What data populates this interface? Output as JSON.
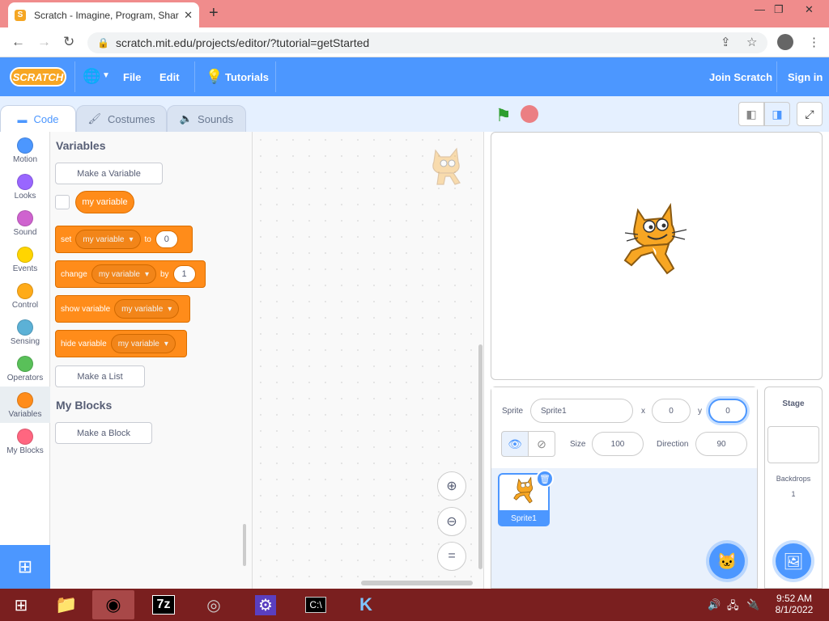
{
  "browser": {
    "tab_title": "Scratch - Imagine, Program, Share",
    "url": "scratch.mit.edu/projects/editor/?tutorial=getStarted",
    "favicon_letter": "S"
  },
  "menubar": {
    "logo": "SCRATCH",
    "file": "File",
    "edit": "Edit",
    "tutorials": "Tutorials",
    "join": "Join Scratch",
    "signin": "Sign in"
  },
  "tabs": [
    "Code",
    "Costumes",
    "Sounds"
  ],
  "categories": [
    {
      "label": "Motion",
      "color": "#4c97ff"
    },
    {
      "label": "Looks",
      "color": "#9966ff"
    },
    {
      "label": "Sound",
      "color": "#cf63cf"
    },
    {
      "label": "Events",
      "color": "#ffd500"
    },
    {
      "label": "Control",
      "color": "#ffab19"
    },
    {
      "label": "Sensing",
      "color": "#5cb1d6"
    },
    {
      "label": "Operators",
      "color": "#59c059"
    },
    {
      "label": "Variables",
      "color": "#ff8c1a"
    },
    {
      "label": "My Blocks",
      "color": "#ff6680"
    }
  ],
  "palette": {
    "variables_heading": "Variables",
    "make_variable": "Make a Variable",
    "variable_reporter": "my variable",
    "set_block": {
      "word": "set",
      "var": "my variable",
      "to": "to",
      "value": "0"
    },
    "change_block": {
      "word": "change",
      "var": "my variable",
      "by": "by",
      "value": "1"
    },
    "show_block": {
      "word": "show variable",
      "var": "my variable"
    },
    "hide_block": {
      "word": "hide variable",
      "var": "my variable"
    },
    "make_list": "Make a List",
    "myblocks_heading": "My Blocks",
    "make_block": "Make a Block"
  },
  "sprite_info": {
    "sprite_label": "Sprite",
    "sprite_name": "Sprite1",
    "x_label": "x",
    "x_value": "0",
    "y_label": "y",
    "y_value": "0",
    "size_label": "Size",
    "size_value": "100",
    "direction_label": "Direction",
    "direction_value": "90"
  },
  "sprite_list": [
    {
      "name": "Sprite1"
    }
  ],
  "stage_target": {
    "title": "Stage",
    "backdrops_label": "Backdrops",
    "backdrops_count": "1"
  },
  "taskbar": {
    "time": "9:52 AM",
    "date": "8/1/2022"
  }
}
